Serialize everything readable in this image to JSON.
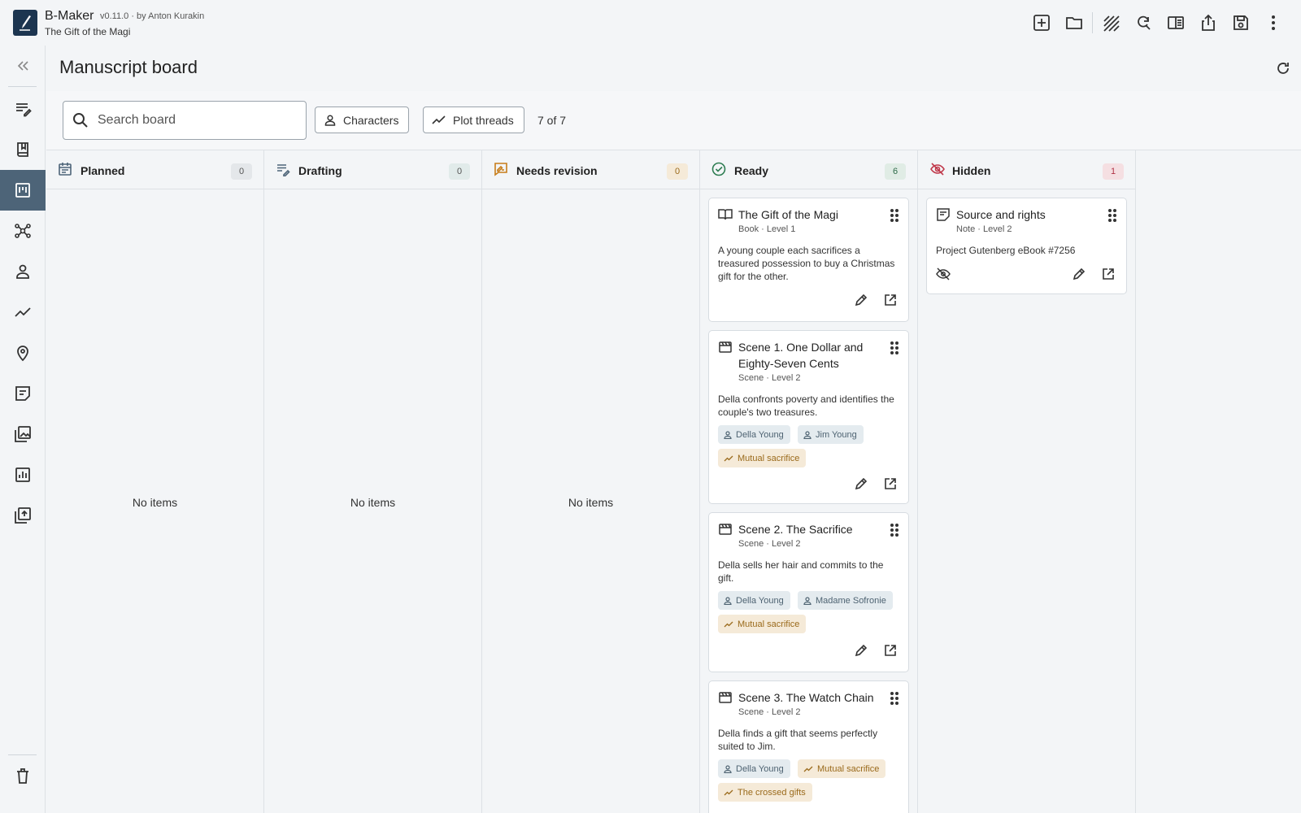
{
  "app": {
    "name": "B-Maker",
    "version": "v0.11.0 · by Anton Kurakin",
    "project": "The Gift of the Magi"
  },
  "page": {
    "title": "Manuscript board"
  },
  "filters": {
    "search_placeholder": "Search board",
    "characters_label": "Characters",
    "plot_threads_label": "Plot threads",
    "count_text": "7 of 7"
  },
  "columns": [
    {
      "title": "Planned",
      "count": "0",
      "empty_text": "No items"
    },
    {
      "title": "Drafting",
      "count": "0",
      "empty_text": "No items"
    },
    {
      "title": "Needs revision",
      "count": "0",
      "empty_text": "No items"
    },
    {
      "title": "Ready",
      "count": "6"
    },
    {
      "title": "Hidden",
      "count": "1"
    }
  ],
  "ready_cards": [
    {
      "title": "The Gift of the Magi",
      "meta": "Book · Level 1",
      "description": "A young couple each sacrifices a treasured possession to buy a Christmas gift for the other."
    },
    {
      "title": "Scene 1. One Dollar and Eighty-Seven Cents",
      "meta": "Scene · Level 2",
      "description": "Della confronts poverty and identifies the couple's two treasures.",
      "characters": [
        "Della Young",
        "Jim Young"
      ],
      "plots": [
        "Mutual sacrifice"
      ]
    },
    {
      "title": "Scene 2. The Sacrifice",
      "meta": "Scene · Level 2",
      "description": "Della sells her hair and commits to the gift.",
      "characters": [
        "Della Young",
        "Madame Sofronie"
      ],
      "plots": [
        "Mutual sacrifice"
      ]
    },
    {
      "title": "Scene 3. The Watch Chain",
      "meta": "Scene · Level 2",
      "description": "Della finds a gift that seems perfectly suited to Jim.",
      "characters": [
        "Della Young"
      ],
      "plots": [
        "Mutual sacrifice",
        "The crossed gifts"
      ]
    }
  ],
  "hidden_cards": [
    {
      "title": "Source and rights",
      "meta": "Note · Level 2",
      "description": "Project Gutenberg eBook #7256"
    }
  ],
  "colors": {
    "accent_sidebar": "#4d6478",
    "ready_green": "#2e7d52",
    "revision_orange": "#c77d1a",
    "hidden_red": "#c0394b",
    "logo_bg": "#1c3550"
  },
  "icons": [
    "new-file-icon",
    "open-folder-icon",
    "stripes-icon",
    "search-replace-icon",
    "split-view-icon",
    "share-icon",
    "save-icon",
    "more-vert-icon"
  ]
}
